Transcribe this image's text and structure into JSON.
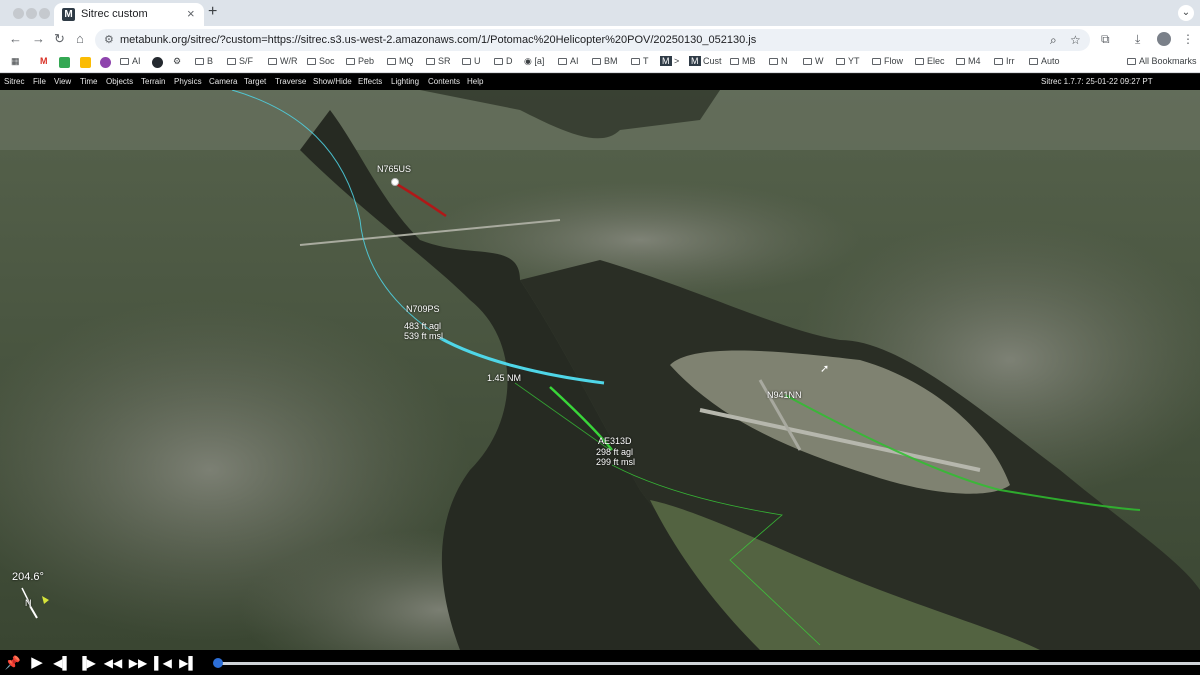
{
  "browser": {
    "tab": {
      "favicon": "M",
      "title": "Sitrec custom",
      "close": "×"
    },
    "new_tab": "+",
    "tab_menu": "⌄",
    "url": "metabunk.org/sitrec/?custom=https://sitrec.s3.us-west-2.amazonaws.com/1/Potomac%20Helicopter%20POV/20250130_052130.js",
    "nav": {
      "back": "←",
      "forward": "→",
      "reload": "↻",
      "home": "⌂"
    },
    "bookmarks": [
      "M",
      "AI",
      "B",
      "S/F",
      "W/R",
      "Soc",
      "Peb",
      "MQ",
      "SR",
      "U",
      "D",
      "[a]",
      "AI",
      "BM",
      "T",
      ">",
      "Cust",
      "MB",
      "N",
      "W",
      "YT",
      "Flow",
      "Elec",
      "M4",
      "Irr",
      "Auto"
    ],
    "all_bookmarks": "All Bookmarks"
  },
  "app": {
    "menu": [
      "Sitrec",
      "File",
      "View",
      "Time",
      "Objects",
      "Terrain",
      "Physics",
      "Camera",
      "Target",
      "Traverse",
      "Show/Hide",
      "Effects",
      "Lighting",
      "Contents",
      "Help"
    ],
    "version": "Sitrec 1.7.7: 25-01-22 09:27 PT"
  },
  "scene": {
    "aircraft": [
      {
        "id": "N765US",
        "lines": [
          "N765US"
        ]
      },
      {
        "id": "N709PS",
        "lines": [
          "N709PS",
          "483 ft agl",
          "539 ft msl"
        ]
      },
      {
        "id": "AE313D",
        "lines": [
          "AE313D",
          "298 ft agl",
          "299 ft msl"
        ]
      },
      {
        "id": "N941NN",
        "lines": [
          "N941NN"
        ]
      }
    ],
    "distance": "1.45 NM",
    "heading": "204.6°",
    "compass_north": "N",
    "colors": {
      "heli_track": "#4fd6e8",
      "jet_track": "#39d639",
      "n765us_track": "#b01818",
      "water": "#262a22",
      "land": "#42503a"
    }
  },
  "timeline": {
    "buttons": [
      "pin",
      "play",
      "step-back",
      "step-forward",
      "rewind",
      "fast-forward",
      "skip-start",
      "skip-end"
    ],
    "glyphs": [
      "📌",
      "▶",
      "◀▌",
      "▐▶",
      "◀◀",
      "▶▶",
      "▌◀",
      "▶▌"
    ],
    "progress": 0.0
  }
}
